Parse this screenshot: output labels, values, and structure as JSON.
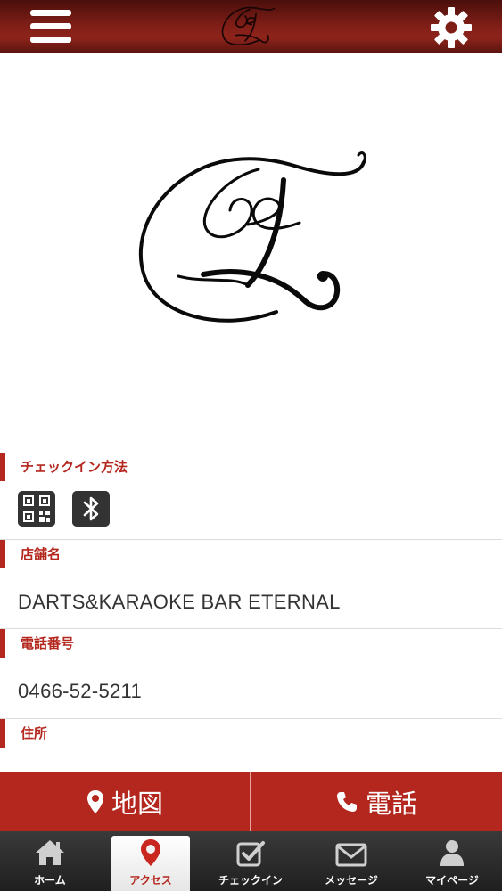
{
  "header": {
    "menu_icon": "hamburger-menu-icon",
    "logo_icon": "eternal-logo-icon",
    "settings_icon": "gear-icon"
  },
  "checkin_method": {
    "label": "チェックイン方法",
    "icons": [
      "qr-code-icon",
      "bluetooth-icon"
    ]
  },
  "store_name": {
    "label": "店舗名",
    "value": "DARTS&KARAOKE BAR ETERNAL"
  },
  "phone": {
    "label": "電話番号",
    "value": "0466-52-5211"
  },
  "address": {
    "label": "住所"
  },
  "actions": {
    "map_label": "地図",
    "tel_label": "電話"
  },
  "tabs": [
    {
      "label": "ホーム",
      "icon": "home-icon"
    },
    {
      "label": "アクセス",
      "icon": "map-pin-icon"
    },
    {
      "label": "チェックイン",
      "icon": "checkbox-icon"
    },
    {
      "label": "メッセージ",
      "icon": "envelope-icon"
    },
    {
      "label": "マイページ",
      "icon": "person-icon"
    }
  ],
  "colors": {
    "accent": "#b3271e",
    "header_dark": "#5a130f",
    "tabbar_bg": "#1f1f1f",
    "text": "#333333"
  }
}
